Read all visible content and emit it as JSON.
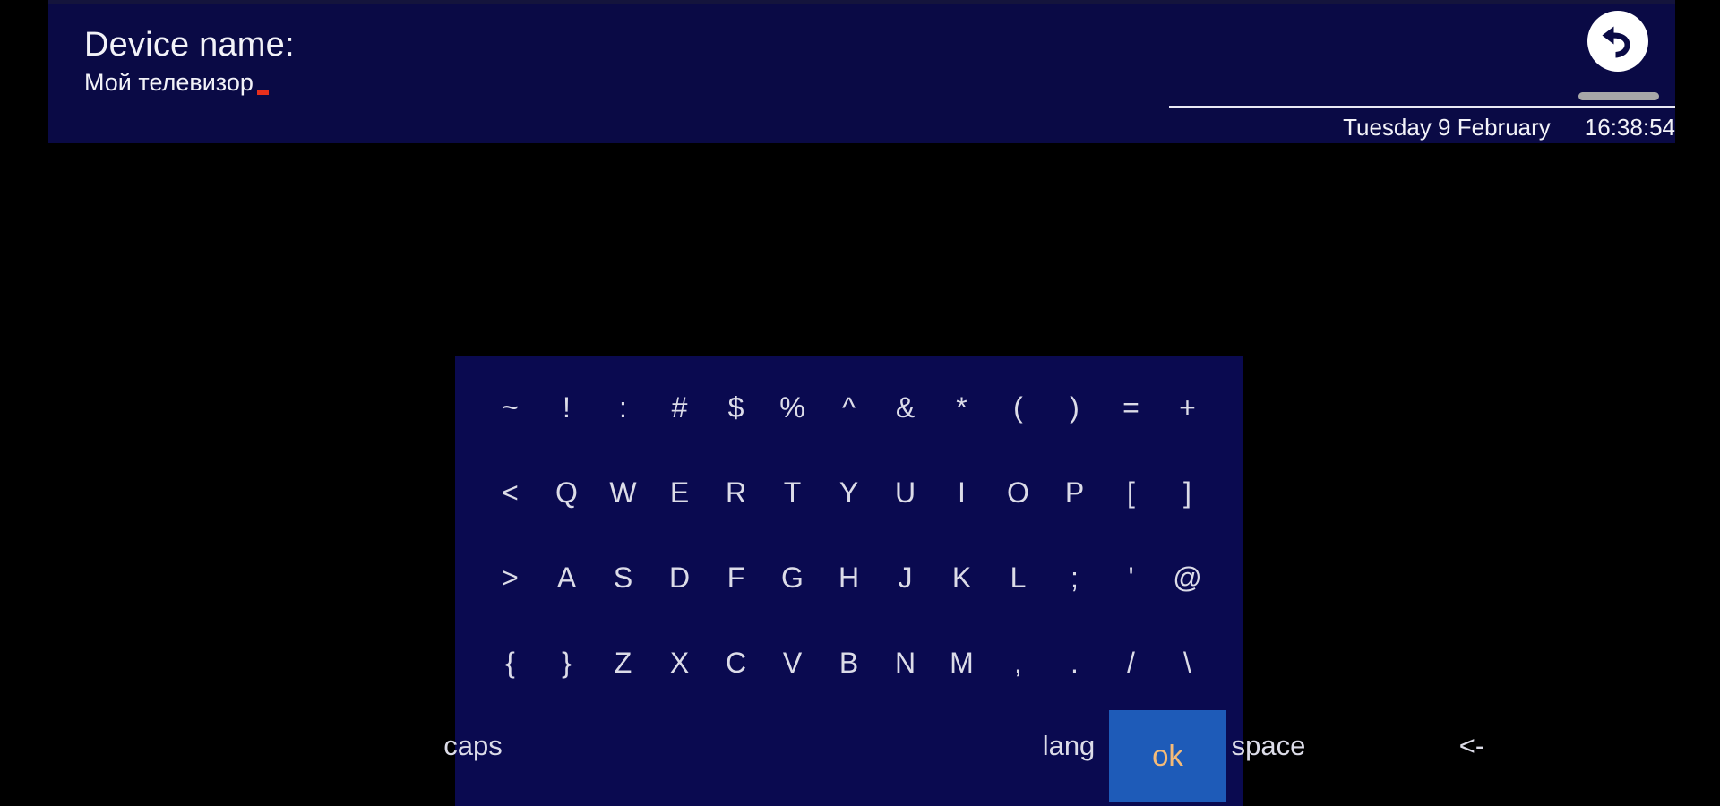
{
  "header": {
    "device_label": "Device name:",
    "device_value": "Мой телевизор",
    "date_text": "Tuesday 9 February",
    "time_text": "16:38:54",
    "back_icon": "back-arrow-icon",
    "colors": {
      "header_bg": "#0a0a45",
      "panel_bg": "#0a0a50",
      "screen_bg": "#000000",
      "text": "#f2f2f8",
      "cursor": "#e8301c",
      "pill": "#a8a8a8",
      "divider": "#e9e9f4"
    }
  },
  "keyboard": {
    "rows": [
      [
        "~",
        "!",
        ":",
        "#",
        "$",
        "%",
        "^",
        "&",
        "*",
        "(",
        ")",
        "=",
        "+"
      ],
      [
        "<",
        "Q",
        "W",
        "E",
        "R",
        "T",
        "Y",
        "U",
        "I",
        "O",
        "P",
        "[",
        "]"
      ],
      [
        ">",
        "A",
        "S",
        "D",
        "F",
        "G",
        "H",
        "J",
        "K",
        "L",
        ";",
        "'",
        "@"
      ],
      [
        "{",
        "}",
        "Z",
        "X",
        "C",
        "V",
        "B",
        "N",
        "M",
        ",",
        ".",
        "/",
        "\\"
      ]
    ],
    "function_keys": {
      "caps": "caps",
      "lang": "lang",
      "space": "space",
      "backspace": "<-",
      "ok": "ok"
    },
    "ok_button_colors": {
      "background": "#1e5bb8",
      "text": "#f5bb78"
    }
  }
}
